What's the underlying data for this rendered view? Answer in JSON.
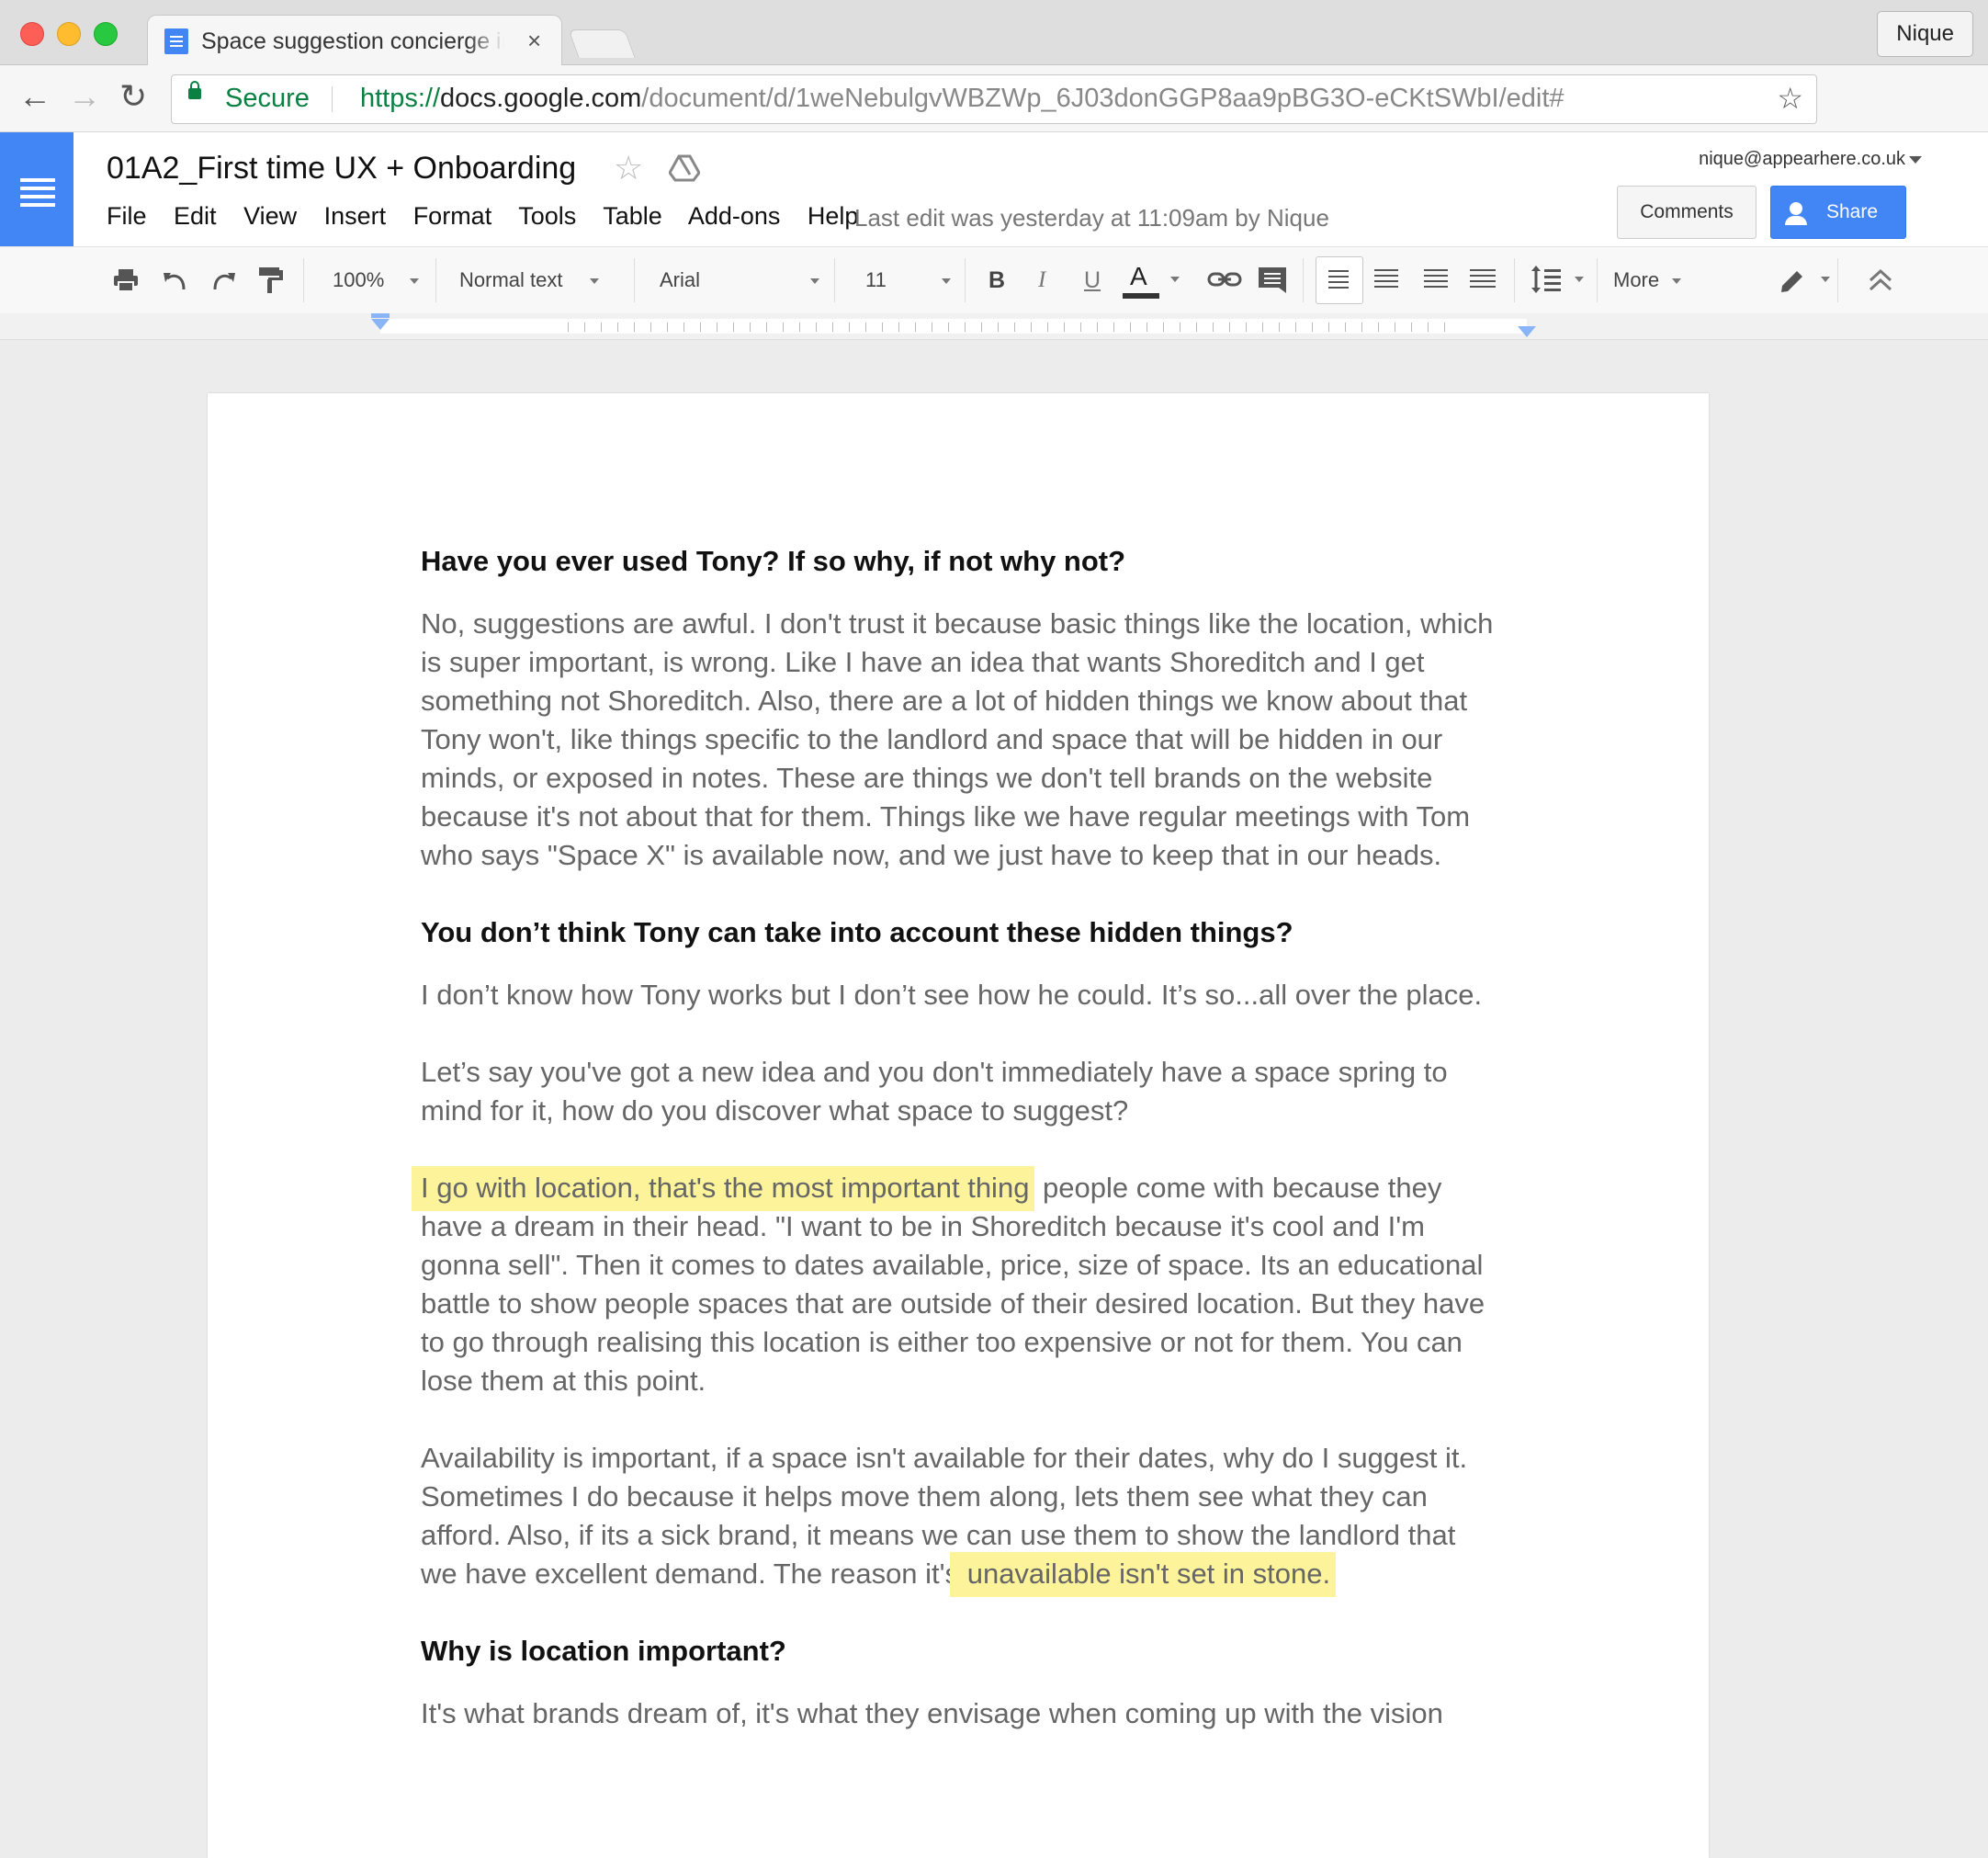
{
  "browser": {
    "tab_title": "Space suggestion concierge interview",
    "tab_close": "×",
    "profile": "Nique",
    "secure_label": "Secure",
    "url_scheme": "https://",
    "url_host": "docs.google.com",
    "url_path": "/document/d/1weNebulgvWBZWp_6J03donGGP8aa9pBG3O-eCKtSWbI/edit#"
  },
  "docs": {
    "title": "01A2_First time UX + Onboarding",
    "account": "nique@appearhere.co.uk",
    "menu": [
      "File",
      "Edit",
      "View",
      "Insert",
      "Format",
      "Tools",
      "Table",
      "Add-ons",
      "Help"
    ],
    "last_edit": "Last edit was yesterday at 11:09am by Nique",
    "comments_label": "Comments",
    "share_label": "Share"
  },
  "format_toolbar": {
    "zoom": "100%",
    "style": "Normal text",
    "font": "Arial",
    "size": "11",
    "bold": "B",
    "italic": "I",
    "underline": "U",
    "text_color": "A",
    "more": "More"
  },
  "document": {
    "q1": "Have you ever used Tony? If so why, if not why not?",
    "a1": "No, suggestions are awful.  I don't trust it because basic things like the location, which is super important, is wrong.  Like I have an idea that wants Shoreditch and I get something not Shoreditch.  Also, there are a lot of hidden things we know about that Tony won't, like things specific to the landlord and space that will be hidden in our minds, or exposed in notes.  These are things we don't tell brands on the website because it's not about that for them. Things like we have regular meetings with Tom who says \"Space X\" is available now, and we just have to keep that in our heads.",
    "q2": "You don’t think Tony can take into account these hidden things?",
    "a2": "I don’t know how Tony works but I don’t see how he could.  It’s so...all over the place.",
    "a3": "Let’s say you've got a new idea and you don't immediately have a space spring to mind for it, how do you discover what space to suggest?",
    "a4_highlight": "I go with location, that's the most important thing",
    "a4_rest": " people come with because they have a dream in their head.  \"I want to be in Shoreditch because it's cool and I'm gonna sell\".  Then it comes to dates available, price, size of space.  Its an educational battle to show people spaces that are outside of their desired location.  But they have to go through realising this location is either too expensive or not for them. You can lose them at this point.",
    "a5_start": "Availability is important, if a space isn't available for their dates, why do I suggest it.  Sometimes I do because it helps move them along, lets them see what they can afford.  Also, if its a sick brand, it means we can use them to show the landlord that we have excellent demand.  The reason it's",
    "a5_highlight": " unavailable isn't set in stone.",
    "q3": "Why is location important?",
    "a6": "It's what brands dream of, it's what they envisage when coming up with the vision"
  },
  "colors": {
    "docs_blue": "#4285f4",
    "highlight": "#fcf39b",
    "secure_green": "#0b8043"
  }
}
